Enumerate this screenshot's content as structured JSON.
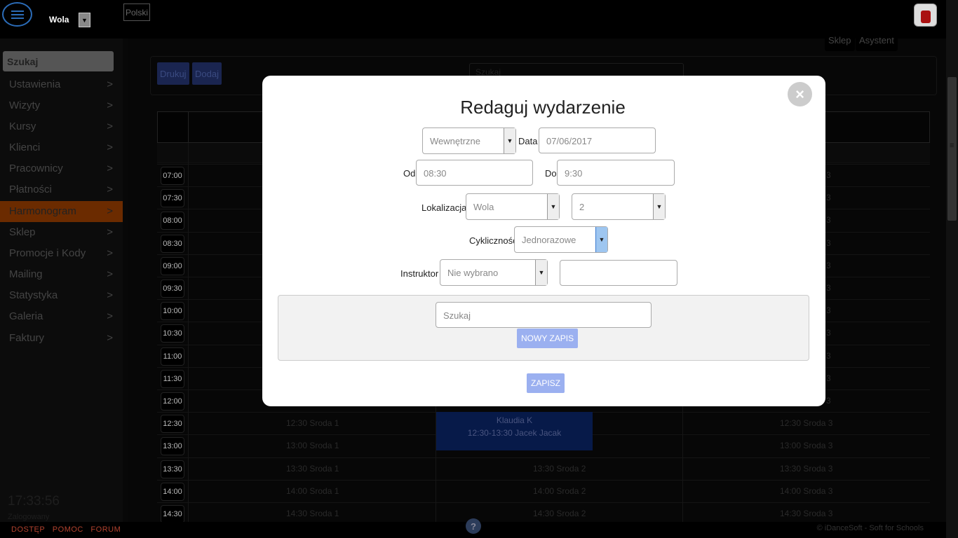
{
  "topbar": {
    "location": "Wola",
    "language": "Polski",
    "shop_label": "Sklep",
    "assistant_label": "Asystent"
  },
  "sidebar": {
    "search_placeholder": "Szukaj",
    "items": [
      {
        "label": "Ustawienia",
        "arrow": ">"
      },
      {
        "label": "Wizyty",
        "arrow": ">"
      },
      {
        "label": "Kursy",
        "arrow": ">"
      },
      {
        "label": "Klienci",
        "arrow": ">"
      },
      {
        "label": "Pracownicy",
        "arrow": ">"
      },
      {
        "label": "Płatności",
        "arrow": ">"
      },
      {
        "label": "Harmonogram",
        "arrow": ">"
      },
      {
        "label": "Sklep",
        "arrow": ">"
      },
      {
        "label": "Promocje i Kody",
        "arrow": ">"
      },
      {
        "label": "Mailing",
        "arrow": ">"
      },
      {
        "label": "Statystyka",
        "arrow": ">"
      },
      {
        "label": "Galeria",
        "arrow": ">"
      },
      {
        "label": "Faktury",
        "arrow": ">"
      }
    ],
    "active_item": "Harmonogram",
    "clock": "17:33:56",
    "login_text": "Zalogowany"
  },
  "toolbar": {
    "print_label": "Drukuj",
    "add_label": "Dodaj",
    "search_placeholder": "Szukaj"
  },
  "schedule": {
    "times": [
      "07:00",
      "07:30",
      "08:00",
      "08:30",
      "09:00",
      "09:30",
      "10:00",
      "10:30",
      "11:00",
      "11:30",
      "12:00",
      "12:30",
      "13:00",
      "13:30",
      "14:00",
      "14:30"
    ],
    "col1": [
      "",
      "",
      "",
      "",
      "",
      "",
      "",
      "",
      "",
      "",
      "",
      "12:30 Sroda 1",
      "13:00 Sroda 1",
      "13:30 Sroda 1",
      "14:00 Sroda 1",
      "14:30 Sroda 1"
    ],
    "col2": [
      "",
      "",
      "",
      "",
      "",
      "",
      "",
      "",
      "",
      "",
      "",
      "",
      "",
      "13:30 Sroda 2",
      "14:00 Sroda 2",
      "14:30 Sroda 2"
    ],
    "col3": [
      "3",
      "3",
      "3",
      "3",
      "3",
      "3",
      "3",
      "3",
      "3",
      "3",
      "3",
      "12:30 Sroda 3",
      "13:00 Sroda 3",
      "13:30 Sroda 3",
      "14:00 Sroda 3",
      "14:30 Sroda 3"
    ],
    "event": {
      "line1": "Klaudia K",
      "line2": "12:30-13:30 Jacek Jacak"
    }
  },
  "footer": {
    "links": [
      "DOSTĘP",
      "POMOC",
      "FORUM"
    ],
    "help": "?",
    "copyright": "© iDanceSoft - Soft for Schools"
  },
  "modal": {
    "title": "Redaguj wydarzenie",
    "close": "×",
    "type_value": "Wewnętrzne",
    "date_label": "Data",
    "date_value": "07/06/2017",
    "from_label": "Od",
    "from_value": "08:30",
    "to_label": "Do",
    "to_value": "9:30",
    "location_label": "Lokalizacja",
    "location_value": "Wola",
    "room_value": "2",
    "recurrence_label": "Cykliczność",
    "recurrence_value": "Jednorazowe",
    "instructor_label": "Instruktor",
    "instructor_value": "Nie wybrano",
    "instructor_extra": "",
    "search_placeholder": "Szukaj",
    "new_entry_label": "NOWY ZAPIS",
    "save_label": "ZAPISZ"
  },
  "colors": {
    "accent_orange": "#b2422e",
    "button_blue": "#9bb0f0",
    "event_blue": "#071a49"
  }
}
